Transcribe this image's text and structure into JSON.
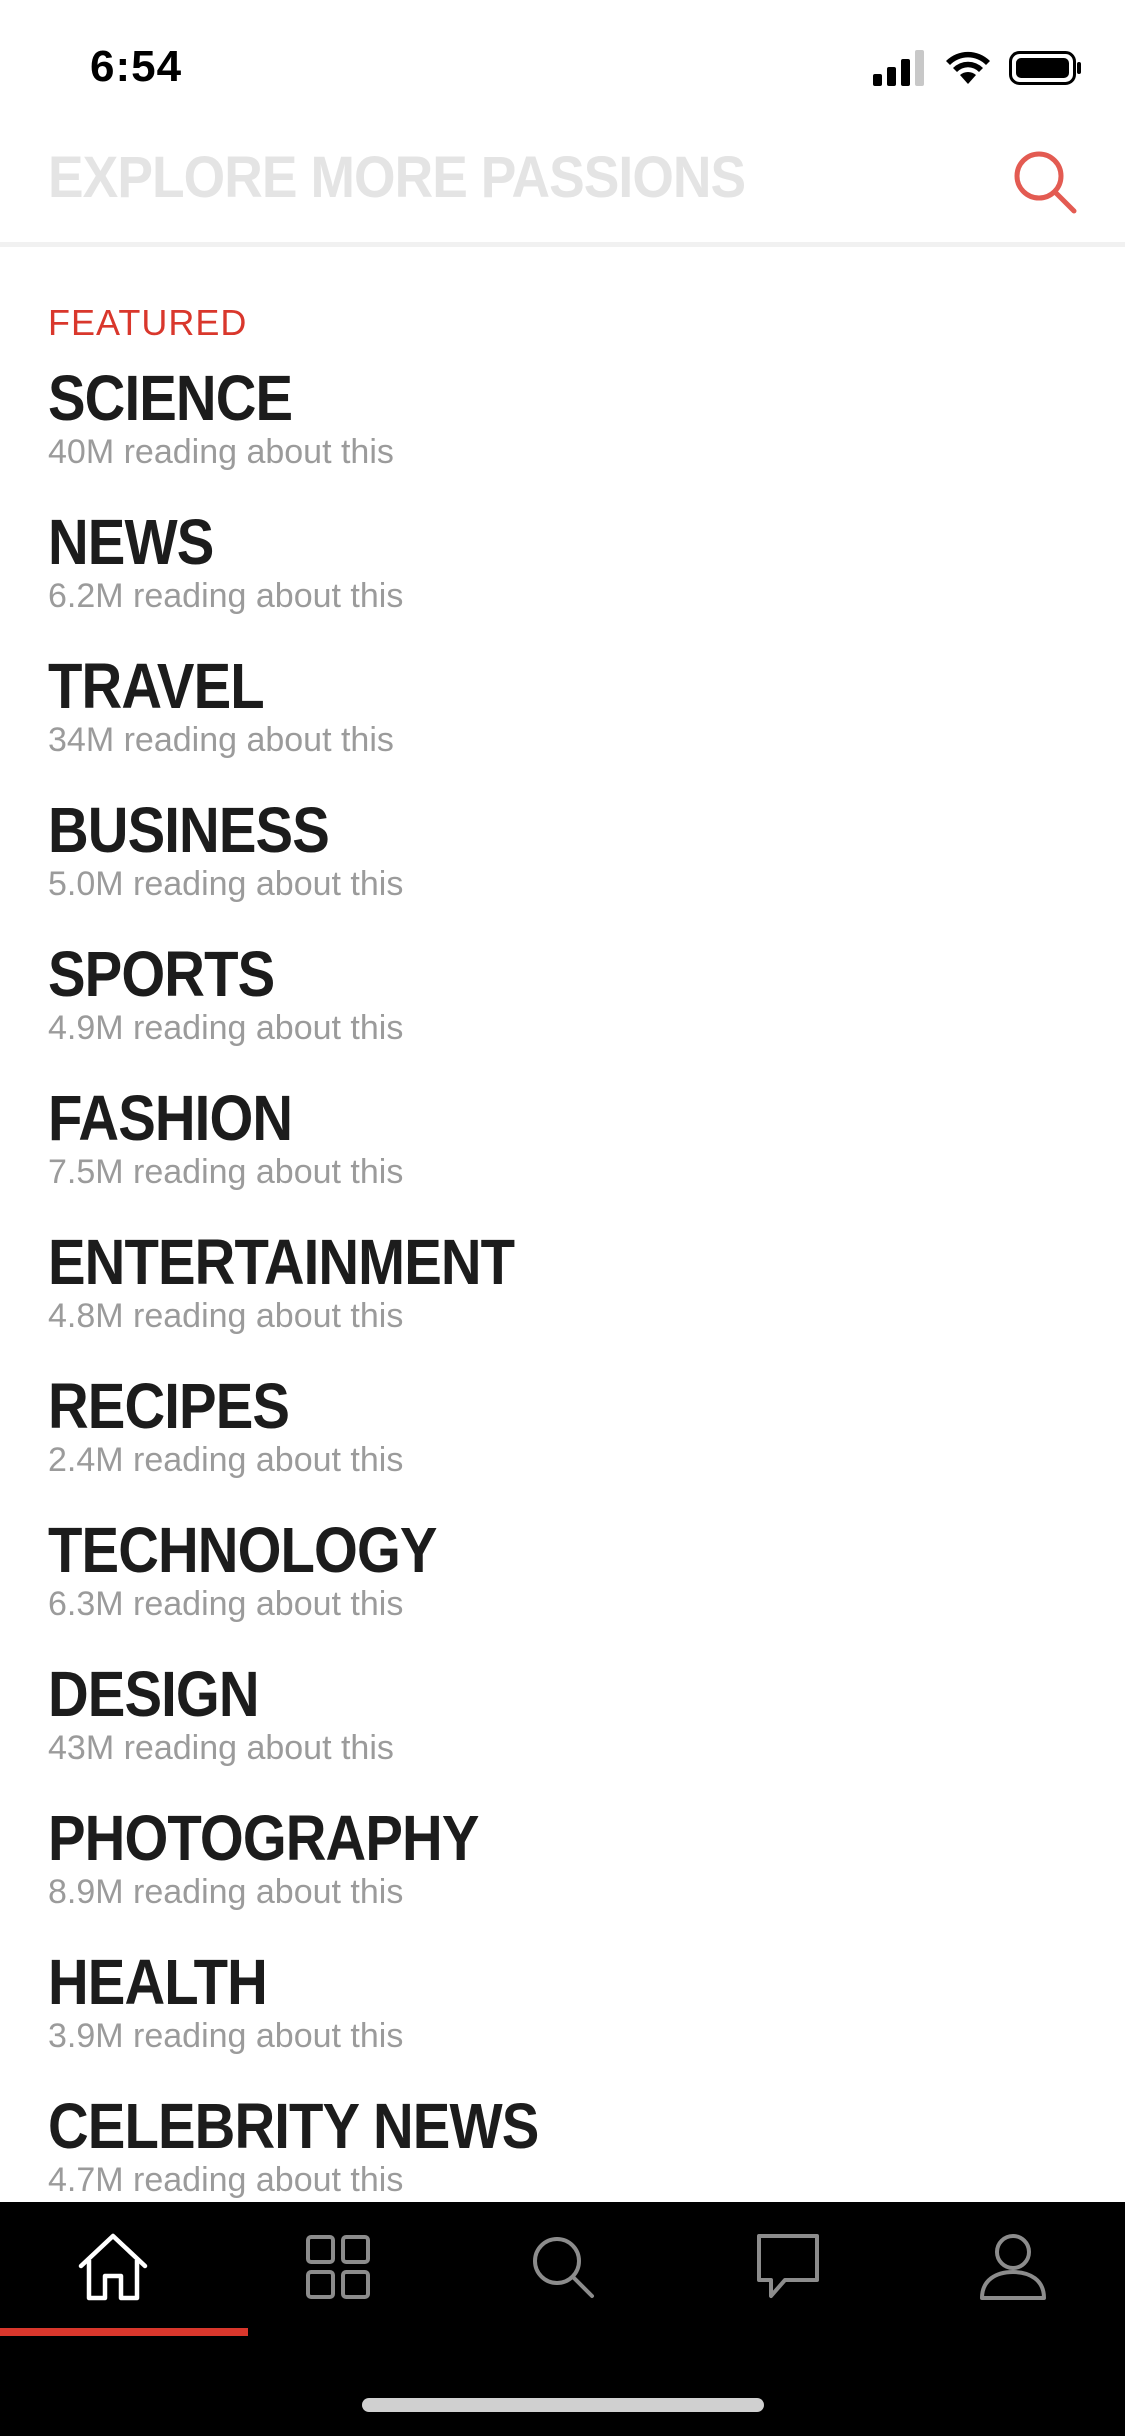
{
  "status_bar": {
    "time": "6:54"
  },
  "header": {
    "title": "EXPLORE MORE PASSIONS",
    "search_icon": "search-icon",
    "accent_color": "#e35b52"
  },
  "featured": {
    "label": "FEATURED",
    "color": "#d9372c"
  },
  "topics": [
    {
      "name": "SCIENCE",
      "count": "40M reading about this"
    },
    {
      "name": "NEWS",
      "count": "6.2M reading about this"
    },
    {
      "name": "TRAVEL",
      "count": "34M reading about this"
    },
    {
      "name": "BUSINESS",
      "count": "5.0M reading about this"
    },
    {
      "name": "SPORTS",
      "count": "4.9M reading about this"
    },
    {
      "name": "FASHION",
      "count": "7.5M reading about this"
    },
    {
      "name": "ENTERTAINMENT",
      "count": "4.8M reading about this"
    },
    {
      "name": "RECIPES",
      "count": "2.4M reading about this"
    },
    {
      "name": "TECHNOLOGY",
      "count": "6.3M reading about this"
    },
    {
      "name": "DESIGN",
      "count": "43M reading about this"
    },
    {
      "name": "PHOTOGRAPHY",
      "count": "8.9M reading about this"
    },
    {
      "name": "HEALTH",
      "count": "3.9M reading about this"
    },
    {
      "name": "CELEBRITY NEWS",
      "count": "4.7M reading about this"
    }
  ],
  "tab_bar": {
    "tabs": [
      {
        "icon": "home-icon",
        "active": true
      },
      {
        "icon": "grid-icon",
        "active": false
      },
      {
        "icon": "search-icon",
        "active": false
      },
      {
        "icon": "chat-bubble-icon",
        "active": false
      },
      {
        "icon": "profile-icon",
        "active": false
      }
    ],
    "active_color": "#d9372c",
    "background": "#000000"
  }
}
